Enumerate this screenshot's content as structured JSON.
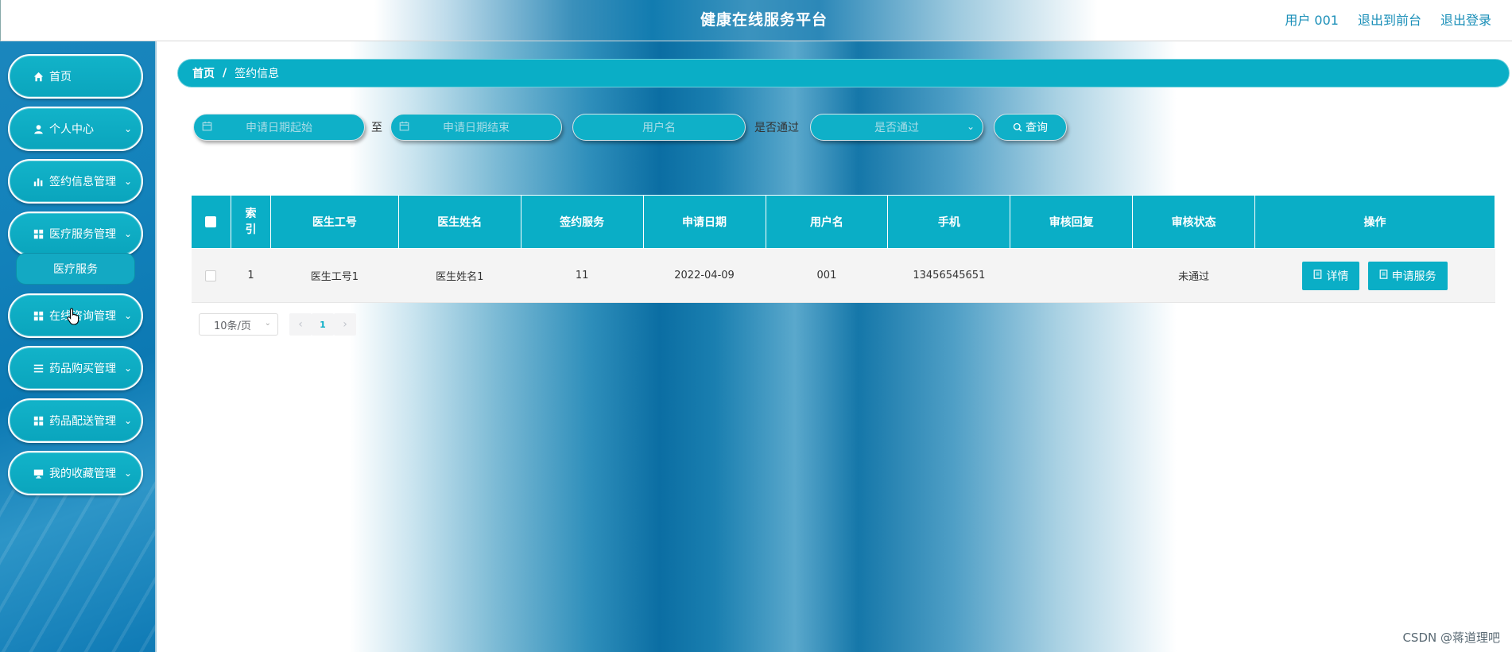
{
  "header": {
    "title": "健康在线服务平台",
    "user_label": "用户 001",
    "to_front": "退出到前台",
    "logout": "退出登录"
  },
  "sidebar": {
    "items": [
      {
        "label": "首页",
        "icon": "home-icon"
      },
      {
        "label": "个人中心",
        "icon": "user-icon"
      },
      {
        "label": "签约信息管理",
        "icon": "bar-chart-icon"
      },
      {
        "label": "医疗服务管理",
        "icon": "grid-icon"
      },
      {
        "label": "在线咨询管理",
        "icon": "grid-icon"
      },
      {
        "label": "药品购买管理",
        "icon": "list-icon"
      },
      {
        "label": "药品配送管理",
        "icon": "grid-icon"
      },
      {
        "label": "我的收藏管理",
        "icon": "monitor-icon"
      }
    ],
    "submenu": {
      "label": "医疗服务"
    }
  },
  "breadcrumb": {
    "home": "首页",
    "separator": "/",
    "current": "签约信息"
  },
  "search": {
    "start_date_placeholder": "申请日期起始",
    "to_label": "至",
    "end_date_placeholder": "申请日期结束",
    "username_placeholder": "用户名",
    "passed_label": "是否通过",
    "passed_placeholder": "是否通过",
    "query_button": "查询"
  },
  "table": {
    "headers": [
      "索引",
      "医生工号",
      "医生姓名",
      "签约服务",
      "申请日期",
      "用户名",
      "手机",
      "审核回复",
      "审核状态",
      "操作"
    ],
    "rows": [
      {
        "index": "1",
        "doctor_no": "医生工号1",
        "doctor_name": "医生姓名1",
        "service": "11",
        "apply_date": "2022-04-09",
        "username": "001",
        "phone": "13456545651",
        "review_reply": "",
        "review_status": "未通过"
      }
    ],
    "actions": {
      "detail": "详情",
      "apply_service": "申请服务"
    }
  },
  "pagination": {
    "page_size": "10条/页",
    "current_page": "1"
  },
  "watermark": "CSDN @蒋道理吧",
  "colors": {
    "accent": "#0aaec6",
    "sidebar": "#1382bb"
  }
}
